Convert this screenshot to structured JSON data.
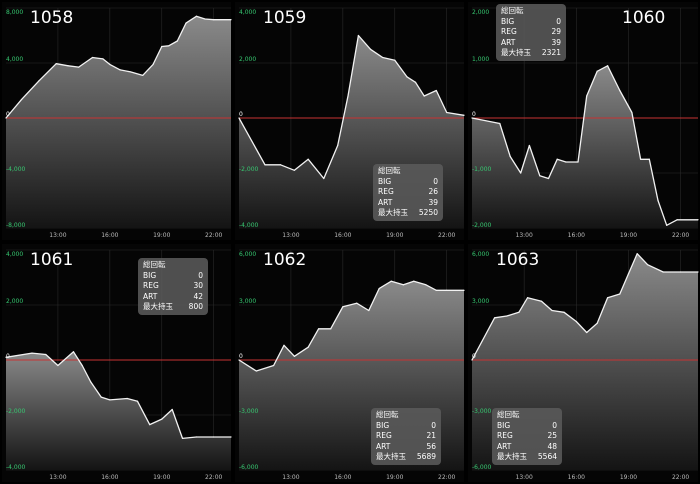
{
  "chart_data": [
    {
      "type": "area",
      "title": "1058",
      "x_ticks": [
        "13:00",
        "16:00",
        "19:00",
        "22:00"
      ],
      "x_range": [
        10.0,
        23.0
      ],
      "ylim": [
        -8000,
        8000
      ],
      "y_ticks": [
        -8000,
        -4000,
        0,
        4000,
        8000
      ],
      "y_tick_labels": [
        "-8,000",
        "-4,000",
        "0",
        "4,000",
        "8,000"
      ],
      "x": [
        10.0,
        10.9,
        11.9,
        12.9,
        13.6,
        14.2,
        15.0,
        15.6,
        16.0,
        16.6,
        17.2,
        17.9,
        18.5,
        19.0,
        19.4,
        19.9,
        20.4,
        21.0,
        21.5,
        22.0,
        23.0
      ],
      "y": [
        0,
        1350,
        2700,
        3950,
        3800,
        3700,
        4400,
        4300,
        3900,
        3500,
        3350,
        3100,
        3900,
        5200,
        5250,
        5600,
        6900,
        7400,
        7200,
        7150,
        7150
      ],
      "stats": null
    },
    {
      "type": "area",
      "title": "1059",
      "x_ticks": [
        "13:00",
        "16:00",
        "19:00",
        "22:00"
      ],
      "x_range": [
        10.0,
        23.0
      ],
      "ylim": [
        -4000,
        4000
      ],
      "y_ticks": [
        -4000,
        -2000,
        0,
        2000,
        4000
      ],
      "y_tick_labels": [
        "-4,000",
        "-2,000",
        "0",
        "2,000",
        "4,000"
      ],
      "x": [
        10.0,
        11.5,
        12.4,
        13.2,
        14.0,
        14.9,
        15.7,
        16.3,
        16.9,
        17.6,
        18.3,
        19.0,
        19.7,
        20.2,
        20.7,
        21.4,
        22.0,
        23.0
      ],
      "y": [
        0,
        -1700,
        -1700,
        -1900,
        -1500,
        -2200,
        -1000,
        800,
        3000,
        2500,
        2200,
        2100,
        1500,
        1300,
        800,
        1000,
        200,
        100
      ],
      "stats": {
        "header": "総回転",
        "rows": [
          {
            "label": "BIG",
            "value": "0"
          },
          {
            "label": "REG",
            "value": "26"
          },
          {
            "label": "ART",
            "value": "39"
          },
          {
            "label": "最大持玉",
            "value": "5250"
          }
        ]
      }
    },
    {
      "type": "area",
      "title": "1060",
      "x_ticks": [
        "13:00",
        "16:00",
        "19:00",
        "22:00"
      ],
      "x_range": [
        10.0,
        23.0
      ],
      "ylim": [
        -2000,
        2000
      ],
      "y_ticks": [
        -2000,
        -1000,
        0,
        1000,
        2000
      ],
      "y_tick_labels": [
        "-2,000",
        "-1,000",
        "0",
        "1,000",
        "2,000"
      ],
      "x": [
        10.0,
        11.6,
        12.2,
        12.8,
        13.3,
        13.9,
        14.4,
        14.9,
        15.4,
        16.1,
        16.6,
        17.2,
        17.8,
        18.5,
        19.2,
        19.7,
        20.2,
        20.7,
        21.2,
        21.8,
        23.0
      ],
      "y": [
        0,
        -100,
        -700,
        -1000,
        -500,
        -1050,
        -1100,
        -750,
        -800,
        -800,
        400,
        850,
        950,
        500,
        100,
        -750,
        -750,
        -1500,
        -1950,
        -1850,
        -1850
      ],
      "stats": {
        "header": "総回転",
        "rows": [
          {
            "label": "BIG",
            "value": "0"
          },
          {
            "label": "REG",
            "value": "29"
          },
          {
            "label": "ART",
            "value": "39"
          },
          {
            "label": "最大持玉",
            "value": "2321"
          }
        ]
      }
    },
    {
      "type": "area",
      "title": "1061",
      "x_ticks": [
        "13:00",
        "16:00",
        "19:00",
        "22:00"
      ],
      "x_range": [
        10.0,
        23.0
      ],
      "ylim": [
        -4000,
        4000
      ],
      "y_ticks": [
        -4000,
        -2000,
        0,
        2000,
        4000
      ],
      "y_tick_labels": [
        "-4,000",
        "-2,000",
        "0",
        "2,000",
        "4,000"
      ],
      "x": [
        10.0,
        11.5,
        12.3,
        13.0,
        13.9,
        14.4,
        14.9,
        15.5,
        16.0,
        17.0,
        17.6,
        18.3,
        19.0,
        19.6,
        20.2,
        21.0,
        22.0,
        23.0
      ],
      "y": [
        100,
        250,
        200,
        -200,
        300,
        -200,
        -800,
        -1350,
        -1450,
        -1400,
        -1500,
        -2350,
        -2150,
        -1800,
        -2850,
        -2800,
        -2800,
        -2800
      ],
      "stats": {
        "header": "総回転",
        "rows": [
          {
            "label": "BIG",
            "value": "0"
          },
          {
            "label": "REG",
            "value": "30"
          },
          {
            "label": "ART",
            "value": "42"
          },
          {
            "label": "最大持玉",
            "value": "800"
          }
        ]
      }
    },
    {
      "type": "area",
      "title": "1062",
      "x_ticks": [
        "13:00",
        "16:00",
        "19:00",
        "22:00"
      ],
      "x_range": [
        10.0,
        23.0
      ],
      "ylim": [
        -6000,
        6000
      ],
      "y_ticks": [
        -6000,
        -3000,
        0,
        3000,
        6000
      ],
      "y_tick_labels": [
        "-6,000",
        "-3,000",
        "0",
        "3,000",
        "6,000"
      ],
      "x": [
        10.0,
        11.0,
        12.0,
        12.6,
        13.2,
        14.0,
        14.6,
        15.3,
        16.0,
        16.8,
        17.5,
        18.1,
        18.8,
        19.5,
        20.1,
        20.8,
        21.4,
        22.0,
        23.0
      ],
      "y": [
        0,
        -600,
        -300,
        800,
        200,
        700,
        1700,
        1700,
        2900,
        3100,
        2700,
        3900,
        4300,
        4100,
        4300,
        4100,
        3800,
        3800,
        3800
      ],
      "stats": {
        "header": "総回転",
        "rows": [
          {
            "label": "BIG",
            "value": "0"
          },
          {
            "label": "REG",
            "value": "21"
          },
          {
            "label": "ART",
            "value": "56"
          },
          {
            "label": "最大持玉",
            "value": "5689"
          }
        ]
      }
    },
    {
      "type": "area",
      "title": "1063",
      "x_ticks": [
        "13:00",
        "16:00",
        "19:00",
        "22:00"
      ],
      "x_range": [
        10.0,
        23.0
      ],
      "ylim": [
        -6000,
        6000
      ],
      "y_ticks": [
        -6000,
        -3000,
        0,
        3000,
        6000
      ],
      "y_tick_labels": [
        "-6,000",
        "-3,000",
        "0",
        "3,000",
        "6,000"
      ],
      "x": [
        10.0,
        11.3,
        12.0,
        12.7,
        13.2,
        14.0,
        14.6,
        15.3,
        16.0,
        16.6,
        17.2,
        17.8,
        18.5,
        19.0,
        19.5,
        20.1,
        21.0,
        22.0,
        23.0
      ],
      "y": [
        0,
        2300,
        2400,
        2600,
        3400,
        3200,
        2700,
        2600,
        2100,
        1500,
        2000,
        3400,
        3600,
        4700,
        5800,
        5200,
        4800,
        4800,
        4800
      ],
      "stats": {
        "header": "総回転",
        "rows": [
          {
            "label": "BIG",
            "value": "0"
          },
          {
            "label": "REG",
            "value": "25"
          },
          {
            "label": "ART",
            "value": "48"
          },
          {
            "label": "最大持玉",
            "value": "5564"
          }
        ]
      }
    }
  ]
}
